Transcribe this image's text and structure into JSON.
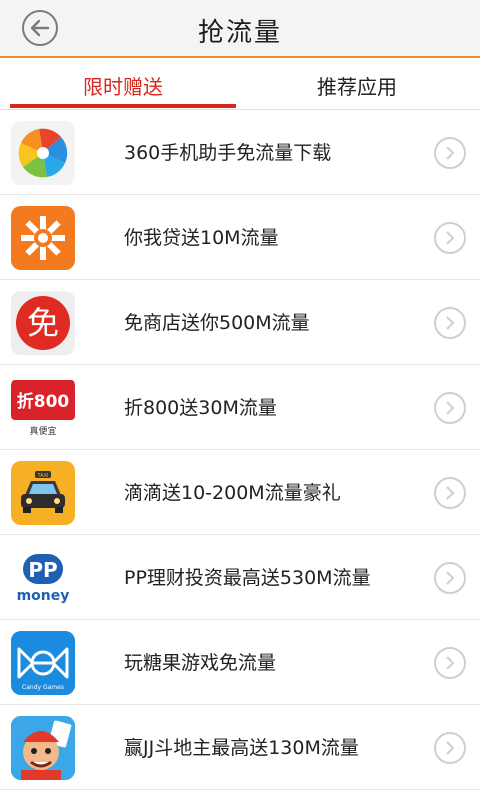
{
  "header": {
    "title": "抢流量",
    "back_icon": "back-arrow-icon"
  },
  "tabs": [
    {
      "label": "限时赠送",
      "active": true
    },
    {
      "label": "推荐应用",
      "active": false
    }
  ],
  "items": [
    {
      "title": "360手机助手免流量下载",
      "icon": "360-assistant-icon"
    },
    {
      "title": "你我贷送10M流量",
      "icon": "niwodai-icon"
    },
    {
      "title": "免商店送你500M流量",
      "icon": "mian-store-icon"
    },
    {
      "title": "折800送30M流量",
      "icon": "zhe800-icon"
    },
    {
      "title": "滴滴送10-200M流量豪礼",
      "icon": "didi-taxi-icon"
    },
    {
      "title": "PP理财投资最高送530M流量",
      "icon": "pp-money-icon"
    },
    {
      "title": "玩糖果游戏免流量",
      "icon": "candy-games-icon"
    },
    {
      "title": "赢JJ斗地主最高送130M流量",
      "icon": "jj-doudizhu-icon"
    }
  ],
  "icon_labels": {
    "zhe800_main": "折800",
    "zhe800_sub": "真便宜",
    "pp_letters": "PP",
    "pp_word": "money",
    "mian_char": "免",
    "taxi_sign": "TAXI",
    "candy_label": "Candy Games"
  },
  "colors": {
    "accent": "#d6281f",
    "header_line": "#e8912a",
    "chevron": "#cfcfcf"
  }
}
